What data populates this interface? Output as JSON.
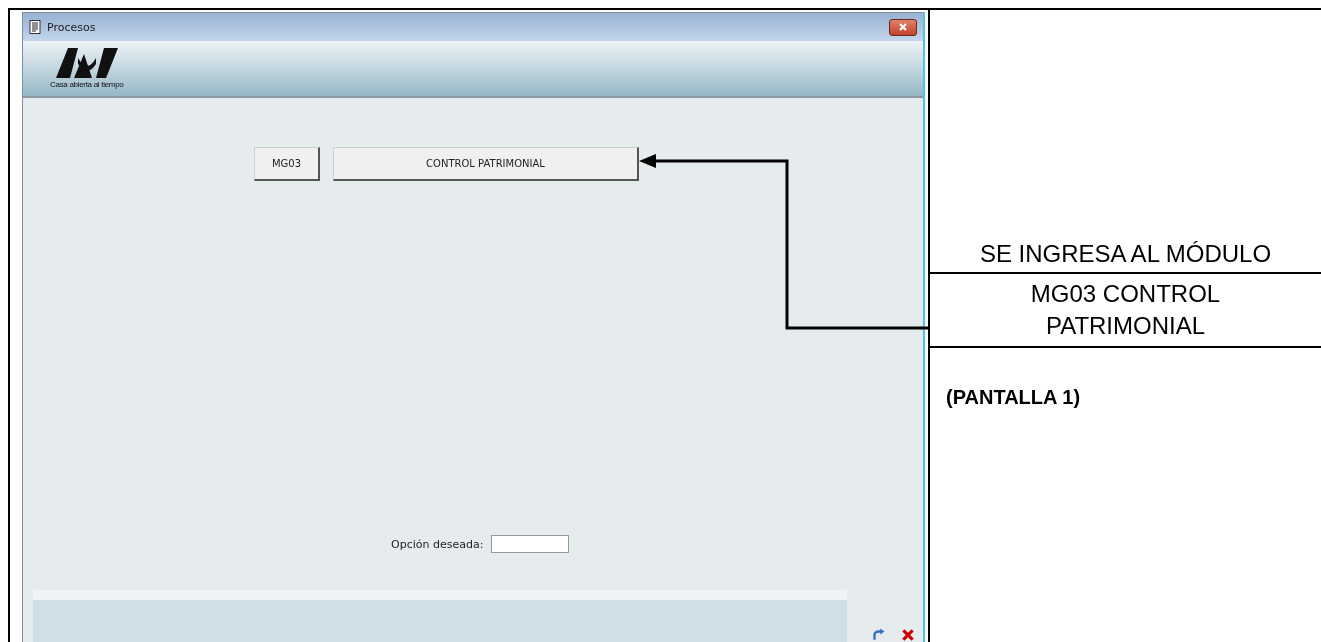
{
  "window": {
    "title": "Procesos",
    "logo_caption": "Casa abierta al tiempo"
  },
  "buttons": [
    {
      "label": "MG03"
    },
    {
      "label": "CONTROL PATRIMONIAL"
    }
  ],
  "option_field": {
    "label": "Opción deseada:"
  },
  "notes": {
    "heading": "SE INGRESA AL MÓDULO",
    "module": "MG03 CONTROL PATRIMONIAL",
    "caption": "(PANTALLA 1)"
  }
}
